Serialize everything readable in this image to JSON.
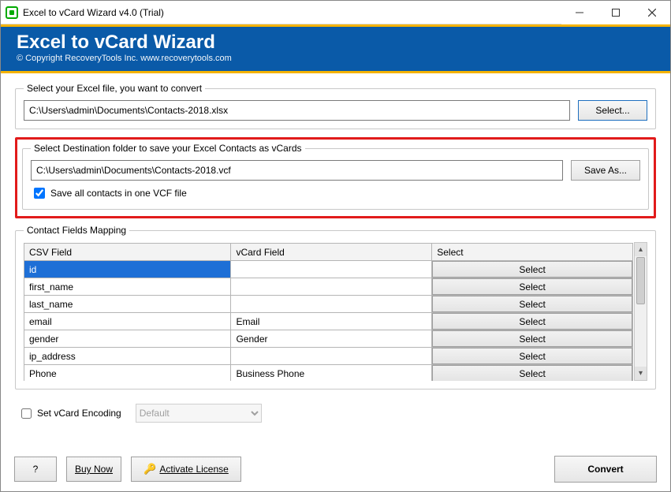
{
  "window": {
    "title": "Excel to vCard Wizard v4.0 (Trial)"
  },
  "header": {
    "title": "Excel to vCard Wizard",
    "copyright": "© Copyright RecoveryTools Inc. www.recoverytools.com"
  },
  "source": {
    "legend": "Select your Excel file, you want to convert",
    "path": "C:\\Users\\admin\\Documents\\Contacts-2018.xlsx",
    "select_label": "Select..."
  },
  "dest": {
    "legend": "Select Destination folder to save your Excel Contacts as vCards",
    "path": "C:\\Users\\admin\\Documents\\Contacts-2018.vcf",
    "saveas_label": "Save As...",
    "single_vcf_checked": true,
    "single_vcf_label": "Save all contacts in one VCF file"
  },
  "mapping": {
    "legend": "Contact Fields Mapping",
    "columns": {
      "csv": "CSV Field",
      "vcard": "vCard Field",
      "select": "Select"
    },
    "select_btn": "Select",
    "rows": [
      {
        "csv": "id",
        "vcard": "",
        "selected": true
      },
      {
        "csv": "first_name",
        "vcard": ""
      },
      {
        "csv": "last_name",
        "vcard": ""
      },
      {
        "csv": "email",
        "vcard": "Email"
      },
      {
        "csv": "gender",
        "vcard": "Gender"
      },
      {
        "csv": "ip_address",
        "vcard": ""
      },
      {
        "csv": "Phone",
        "vcard": "Business Phone"
      }
    ]
  },
  "encoding": {
    "checkbox_label": "Set vCard Encoding",
    "checked": false,
    "value": "Default"
  },
  "footer": {
    "help": "?",
    "buy": "Buy Now",
    "activate": "Activate License",
    "convert": "Convert"
  }
}
